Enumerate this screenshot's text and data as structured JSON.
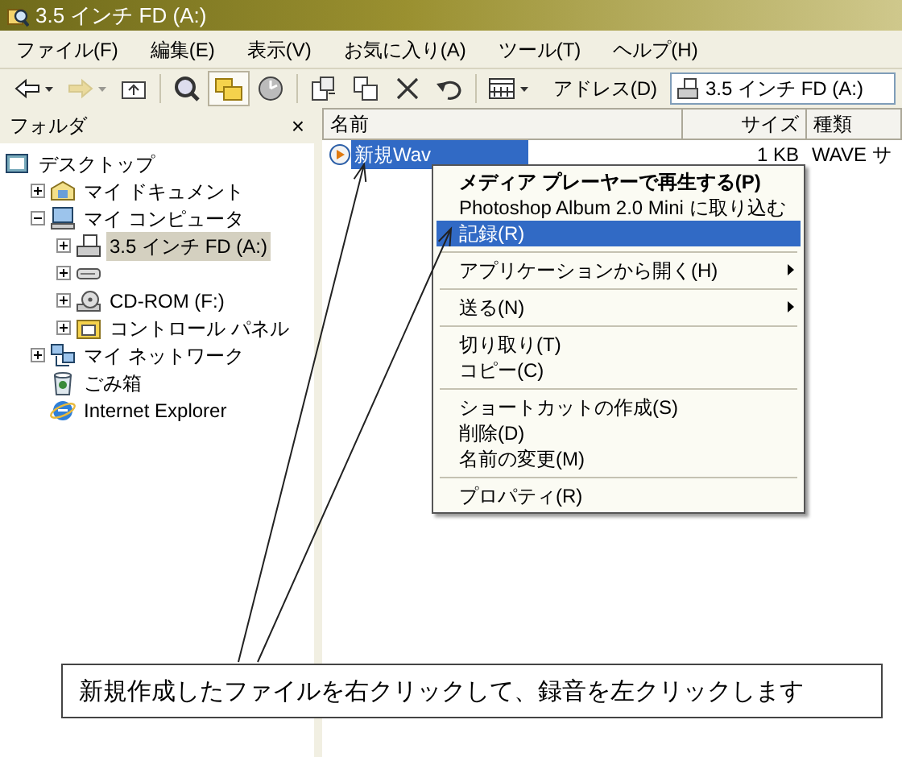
{
  "window": {
    "title": "3.5 インチ FD (A:)"
  },
  "menu_bar": [
    "ファイル(F)",
    "編集(E)",
    "表示(V)",
    "お気に入り(A)",
    "ツール(T)",
    "ヘルプ(H)"
  ],
  "toolbar": [
    {
      "kind": "back",
      "disabled": false,
      "pressed": false
    },
    {
      "kind": "forward",
      "disabled": true,
      "pressed": false
    },
    {
      "kind": "up",
      "disabled": false,
      "pressed": false
    },
    {
      "kind": "search",
      "disabled": false,
      "pressed": false
    },
    {
      "kind": "folders",
      "disabled": false,
      "pressed": true
    },
    {
      "kind": "history",
      "disabled": false,
      "pressed": false
    },
    {
      "kind": "move",
      "disabled": false,
      "pressed": false
    },
    {
      "kind": "copy",
      "disabled": false,
      "pressed": false
    },
    {
      "kind": "delete",
      "disabled": false,
      "pressed": false
    },
    {
      "kind": "undo",
      "disabled": false,
      "pressed": false
    },
    {
      "kind": "views",
      "disabled": false,
      "pressed": false
    }
  ],
  "address": {
    "label": "アドレス(D)",
    "value": "3.5 インチ FD (A:)"
  },
  "folder_pane": {
    "title": "フォルダ",
    "close": "×"
  },
  "tree": [
    {
      "label": "デスクトップ",
      "kind": "desktop",
      "selected": false,
      "children": [
        {
          "label": "マイ ドキュメント",
          "kind": "documents",
          "expanded": false,
          "selected": false
        },
        {
          "label": "マイ コンピュータ",
          "kind": "computer",
          "expanded": true,
          "selected": false,
          "children": [
            {
              "label": "3.5 インチ FD (A:)",
              "kind": "floppy",
              "expanded": false,
              "selected": true
            },
            {
              "kind": "drive",
              "expanded": false
            },
            {
              "label": "CD-ROM (F:)",
              "kind": "cdrom",
              "expanded": false,
              "selected": false
            },
            {
              "label": "コントロール パネル",
              "kind": "control",
              "expanded": false,
              "selected": false
            }
          ]
        },
        {
          "label": "マイ ネットワーク",
          "kind": "network",
          "expanded": false,
          "selected": false
        },
        {
          "label": "ごみ箱",
          "kind": "trash",
          "selected": false
        },
        {
          "label": "Internet Explorer",
          "kind": "browser",
          "selected": false
        }
      ]
    }
  ],
  "file_list": {
    "columns": [
      "名前",
      "サイズ",
      "種類"
    ],
    "rows": [
      {
        "name": "新規Wav",
        "size": "1 KB",
        "type": "WAVE サ",
        "selected": true
      }
    ]
  },
  "context_menu": [
    {
      "kind": "item",
      "label": "メディア プレーヤーで再生する(P)",
      "default": true,
      "selected": false,
      "submenu": false
    },
    {
      "kind": "item",
      "label": "Photoshop Album 2.0 Mini に取り込む",
      "default": false,
      "selected": false,
      "submenu": false
    },
    {
      "kind": "item",
      "label": "記録(R)",
      "default": false,
      "selected": true,
      "submenu": false
    },
    {
      "kind": "separator"
    },
    {
      "kind": "item",
      "label": "アプリケーションから開く(H)",
      "default": false,
      "selected": false,
      "submenu": true
    },
    {
      "kind": "separator"
    },
    {
      "kind": "item",
      "label": "送る(N)",
      "default": false,
      "selected": false,
      "submenu": true
    },
    {
      "kind": "separator"
    },
    {
      "kind": "item",
      "label": "切り取り(T)",
      "default": false,
      "selected": false,
      "submenu": false
    },
    {
      "kind": "item",
      "label": "コピー(C)",
      "default": false,
      "selected": false,
      "submenu": false
    },
    {
      "kind": "separator"
    },
    {
      "kind": "item",
      "label": "ショートカットの作成(S)",
      "default": false,
      "selected": false,
      "submenu": false
    },
    {
      "kind": "item",
      "label": "削除(D)",
      "default": false,
      "selected": false,
      "submenu": false
    },
    {
      "kind": "item",
      "label": "名前の変更(M)",
      "default": false,
      "selected": false,
      "submenu": false
    },
    {
      "kind": "separator"
    },
    {
      "kind": "item",
      "label": "プロパティ(R)",
      "default": false,
      "selected": false,
      "submenu": false
    }
  ],
  "annotation": {
    "text": "新規作成したファイルを右クリックして、録音を左クリックします"
  }
}
